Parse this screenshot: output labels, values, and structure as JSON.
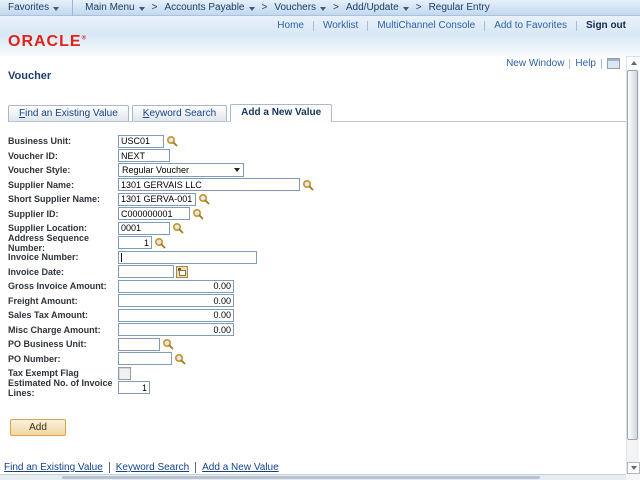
{
  "topbar": {
    "favorites_label": "Favorites",
    "separator": ">",
    "items": {
      "main_menu": "Main Menu",
      "accounts_payable": "Accounts Payable",
      "vouchers": "Vouchers",
      "add_update": "Add/Update",
      "regular_entry": "Regular Entry"
    }
  },
  "header": {
    "logo_text": "ORACLE",
    "logo_mark": "®",
    "links": {
      "home": "Home",
      "worklist": "Worklist",
      "multichannel": "MultiChannel Console",
      "add_to_favorites": "Add to Favorites",
      "sign_out": "Sign out"
    }
  },
  "utility": {
    "new_window": "New Window",
    "help": "Help"
  },
  "page_title": "Voucher",
  "tabs": {
    "find": {
      "key": "F",
      "rest": "ind an Existing Value"
    },
    "keyword": {
      "key": "K",
      "rest": "eyword Search"
    },
    "add": {
      "label": "Add a New Value"
    }
  },
  "form": {
    "business_unit": {
      "label": "Business Unit:",
      "value": "USC01"
    },
    "voucher_id": {
      "label": "Voucher ID:",
      "value": "NEXT"
    },
    "voucher_style": {
      "label": "Voucher Style:",
      "value": "Regular Voucher"
    },
    "supplier_name": {
      "label": "Supplier Name:",
      "value": "1301 GERVAIS LLC"
    },
    "short_supplier_name": {
      "label": "Short Supplier Name:",
      "value": "1301 GERVA-001"
    },
    "supplier_id": {
      "label": "Supplier ID:",
      "value": "C000000001"
    },
    "supplier_location": {
      "label": "Supplier Location:",
      "value": "0001"
    },
    "address_sequence_number": {
      "label": "Address Sequence Number:",
      "value": "1"
    },
    "invoice_number": {
      "label": "Invoice Number:",
      "value": ""
    },
    "invoice_date": {
      "label": "Invoice Date:",
      "value": ""
    },
    "gross_invoice_amount": {
      "label": "Gross Invoice Amount:",
      "value": "0.00"
    },
    "freight_amount": {
      "label": "Freight Amount:",
      "value": "0.00"
    },
    "sales_tax_amount": {
      "label": "Sales Tax Amount:",
      "value": "0.00"
    },
    "misc_charge_amount": {
      "label": "Misc Charge Amount:",
      "value": "0.00"
    },
    "po_business_unit": {
      "label": "PO Business Unit:",
      "value": ""
    },
    "po_number": {
      "label": "PO Number:",
      "value": ""
    },
    "tax_exempt_flag": {
      "label": "Tax Exempt Flag",
      "checked": false
    },
    "estimated_invoice_lines": {
      "label": "Estimated No. of Invoice Lines:",
      "value": "1"
    }
  },
  "add_button_label": "Add",
  "bottom_links": {
    "find": "Find an Existing Value",
    "keyword": "Keyword Search",
    "add": "Add a New Value"
  }
}
